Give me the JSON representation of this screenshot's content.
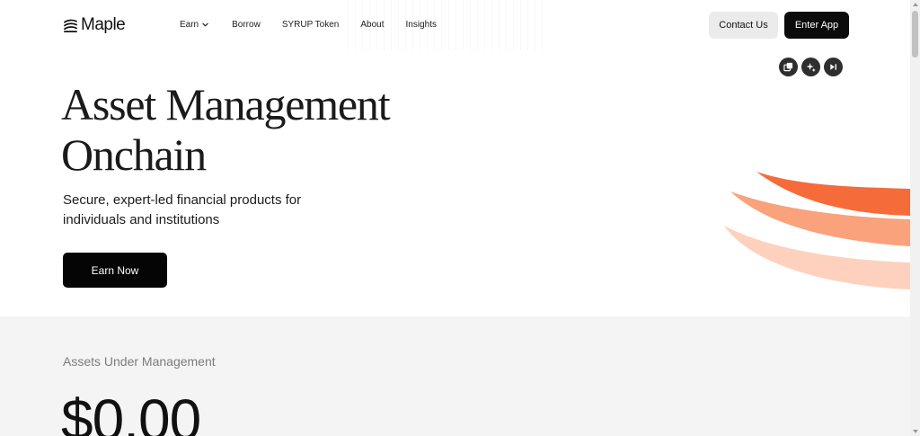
{
  "header": {
    "logo_text": "Maple",
    "nav": {
      "earn": "Earn",
      "borrow": "Borrow",
      "syrup": "SYRUP Token",
      "about": "About",
      "insights": "Insights"
    },
    "contact_label": "Contact Us",
    "enter_label": "Enter App"
  },
  "tools": [
    "copy-icon",
    "sparkle-add-icon",
    "skip-icon"
  ],
  "hero": {
    "title_line1": "Asset Management",
    "title_line2": "Onchain",
    "subtitle": "Secure, expert-led financial products for individuals and institutions",
    "cta_label": "Earn Now"
  },
  "aum": {
    "label": "Assets Under Management",
    "value": "$0.00"
  },
  "colors": {
    "accent_dark": "#f56b3a",
    "accent_mid": "#f9a27c",
    "accent_light": "#fdd1bd",
    "button_dark": "#050505",
    "section_bg": "#f4f4f4"
  }
}
